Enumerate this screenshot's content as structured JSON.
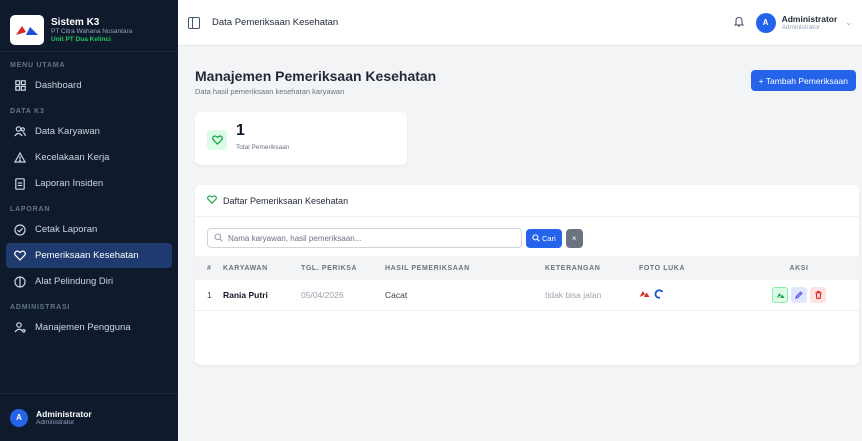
{
  "brand": {
    "title": "Sistem K3",
    "company": "PT Citra Wahana Nusantara",
    "unit": "Unit PT Dua Kelinci"
  },
  "sidebar": {
    "sections": [
      {
        "label": "MENU UTAMA",
        "items": [
          {
            "label": "Dashboard",
            "icon": "grid-icon"
          }
        ]
      },
      {
        "label": "DATA K3",
        "items": [
          {
            "label": "Data Karyawan",
            "icon": "users-icon"
          },
          {
            "label": "Kecelakaan Kerja",
            "icon": "warning-icon"
          },
          {
            "label": "Laporan Insiden",
            "icon": "document-icon"
          }
        ]
      },
      {
        "label": "LAPORAN",
        "items": [
          {
            "label": "Cetak Laporan",
            "icon": "printer-icon"
          },
          {
            "label": "Pemeriksaan Kesehatan",
            "icon": "health-icon",
            "active": true
          },
          {
            "label": "Alat Pelindung Diri",
            "icon": "shield-icon"
          }
        ]
      },
      {
        "label": "ADMINISTRASI",
        "items": [
          {
            "label": "Manajemen Pengguna",
            "icon": "user-settings-icon"
          }
        ]
      }
    ],
    "user": {
      "initial": "A",
      "name": "Administrator",
      "role": "Administrator"
    }
  },
  "header": {
    "title": "Data Pemeriksaan Kesehatan",
    "user": {
      "initial": "A",
      "name": "Administrator",
      "role": "Administrator"
    }
  },
  "main": {
    "title": "Manajemen Pemeriksaan Kesehatan",
    "subtitle": "Data hasil pemeriksaan kesehatan karyawan",
    "add_button": "+ Tambah Pemeriksaan",
    "stat": {
      "value": "1",
      "label": "Total Pemeriksaan"
    },
    "list": {
      "title": "Daftar Pemeriksaan Kesehatan",
      "search_placeholder": "Nama karyawan, hasil pemeriksaan...",
      "search_button": "Cari",
      "clear_button": "×",
      "columns": [
        "#",
        "KARYAWAN",
        "TGL. PERIKSA",
        "HASIL PEMERIKSAAN",
        "KETERANGAN",
        "FOTO LUKA",
        "AKSI"
      ],
      "rows": [
        {
          "no": "1",
          "karyawan": "Rania Putri",
          "tgl": "05/04/2026",
          "hasil": "Cacat",
          "keterangan": "tidak bisa jalan"
        }
      ]
    }
  },
  "colors": {
    "accent": "#2563eb",
    "sidebar_bg": "#0f1b2d",
    "active_nav": "#1e3a6e",
    "success": "#16a34a",
    "danger": "#dc2626"
  }
}
